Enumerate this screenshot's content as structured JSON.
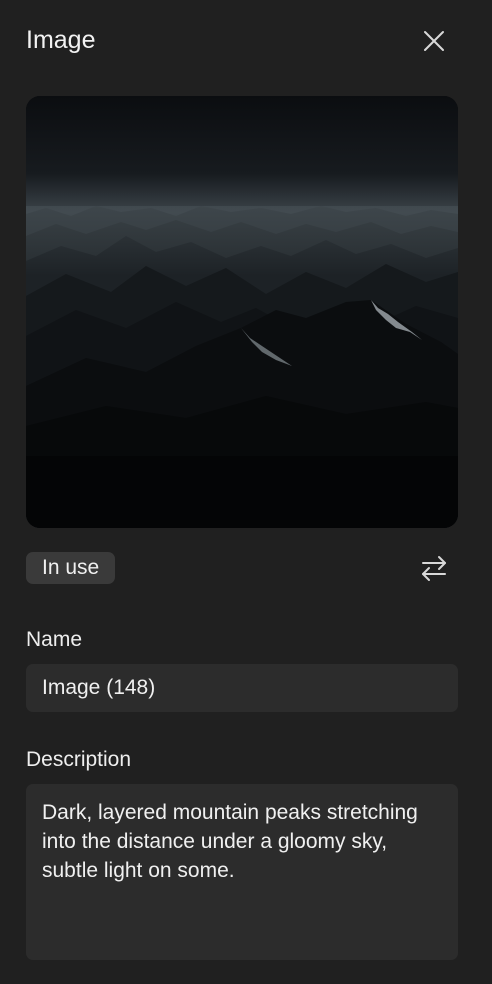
{
  "panel": {
    "title": "Image",
    "close_icon": "close-icon"
  },
  "preview": {
    "subject": "dark layered mountain peaks under gloomy sky"
  },
  "status": {
    "badge_label": "In use",
    "replace_icon": "swap-arrows-icon"
  },
  "fields": {
    "name_label": "Name",
    "name_value": "Image (148)",
    "description_label": "Description",
    "description_value": "Dark, layered mountain peaks stretching into the distance under a gloomy sky, subtle light on some."
  },
  "colors": {
    "background": "#202020",
    "input_background": "#2c2c2c",
    "badge_background": "#3a3a3a",
    "text": "#ececec"
  }
}
